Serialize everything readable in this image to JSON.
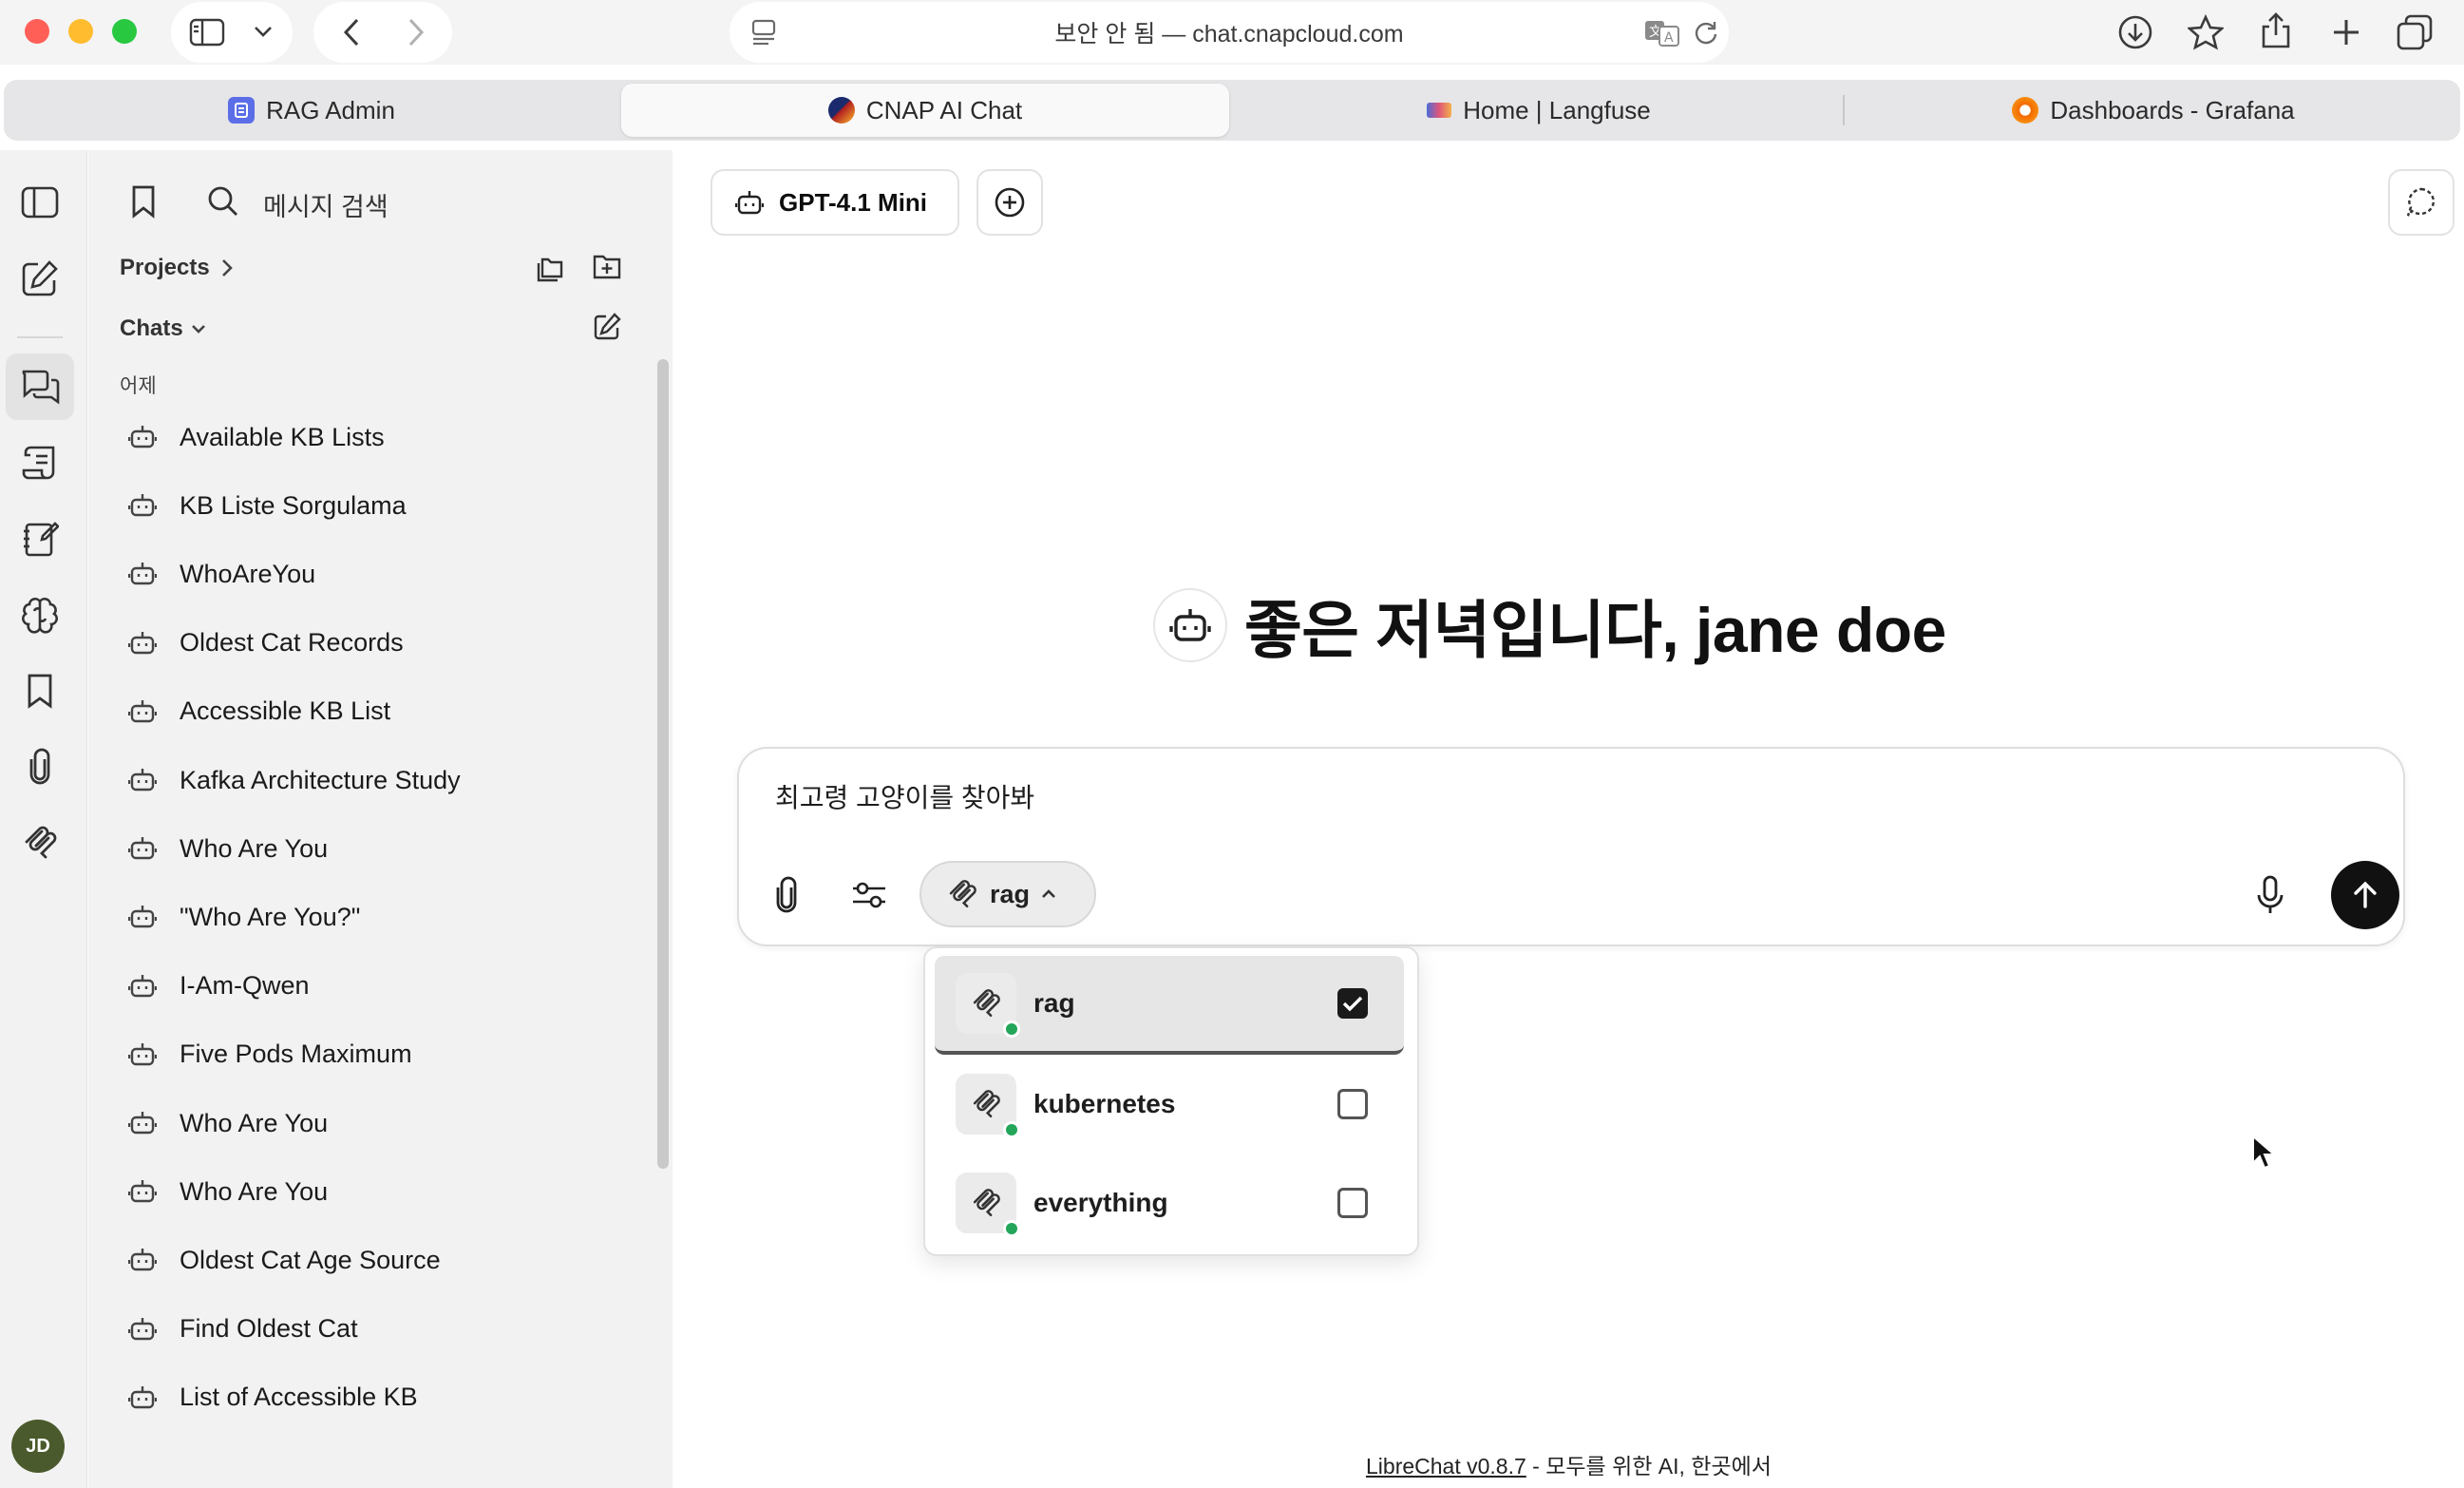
{
  "browser": {
    "url": "보안 안 됨 — chat.cnapcloud.com",
    "tabs": [
      {
        "label": "RAG Admin",
        "favicon": "rag-admin-favicon"
      },
      {
        "label": "CNAP AI Chat",
        "favicon": "cnap-favicon",
        "active": true
      },
      {
        "label": "Home | Langfuse",
        "favicon": "langfuse-favicon"
      },
      {
        "label": "Dashboards - Grafana",
        "favicon": "grafana-favicon"
      }
    ]
  },
  "sidebar": {
    "search_placeholder": "메시지 검색",
    "projects_label": "Projects",
    "chats_label": "Chats",
    "date_group": "어제",
    "chats": [
      "Available KB Lists",
      "KB Liste Sorgulama",
      "WhoAreYou",
      "Oldest Cat Records",
      "Accessible KB List",
      "Kafka Architecture Study",
      "Who Are You",
      "\"Who Are You?\"",
      "I-Am-Qwen",
      "Five Pods Maximum",
      "Who Are You",
      "Who Are You",
      "Oldest Cat Age Source",
      "Find Oldest Cat",
      "List of Accessible KB"
    ],
    "avatar_initials": "JD"
  },
  "main": {
    "model_name": "GPT-4.1 Mini",
    "greeting": "좋은 저녁입니다, jane doe",
    "input_text": "최고령 고양이를 찾아봐",
    "mcp_selected": "rag",
    "mcp_options": [
      {
        "label": "rag",
        "checked": true
      },
      {
        "label": "kubernetes",
        "checked": false
      },
      {
        "label": "everything",
        "checked": false
      }
    ],
    "footer_link": "LibreChat v0.8.7",
    "footer_text": " - 모두를 위한 AI, 한곳에서"
  },
  "colors": {
    "status_online": "#23a55a",
    "send_button": "#111111",
    "traffic_close": "#ff5f57",
    "traffic_min": "#febc2e",
    "traffic_max": "#28c840"
  }
}
